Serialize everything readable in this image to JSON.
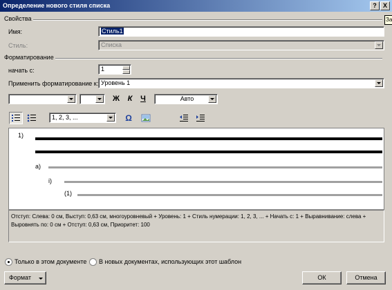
{
  "window": {
    "title": "Определение нового стиля списка",
    "help_button": "?",
    "close_button": "X",
    "tooltip": "Закрыть"
  },
  "properties": {
    "group_label": "Свойства",
    "name_label": "Имя:",
    "name_value": "Стиль1",
    "style_label": "Стиль:",
    "style_value": "Списка"
  },
  "formatting": {
    "group_label": "Форматирование",
    "start_label": "начать с:",
    "start_value": "1",
    "apply_label": "Применить форматирование к:",
    "apply_value": "Уровень 1",
    "bold": "Ж",
    "italic": "К",
    "underline": "Ч",
    "font_color": "Авто",
    "numbering_value": "1, 2, 3, ..."
  },
  "preview": {
    "levels": [
      "1)",
      "a)",
      "i)",
      "(1)"
    ]
  },
  "description": "Отступ: Слева: 0 см, Выступ: 0,63 см, многоуровневый + Уровень: 1 + Стиль нумерации: 1, 2, 3, ... + Начать с: 1 + Выравнивание: слева + Выровнять по: 0 см + Отступ: 0,63 см, Приоритет: 100",
  "scope": {
    "only_this_document": "Только в этом документе",
    "new_documents": "В новых документах, использующих этот шаблон",
    "selected": "only_this_document"
  },
  "buttons": {
    "format": "Формат",
    "ok": "ОК",
    "cancel": "Отмена"
  }
}
